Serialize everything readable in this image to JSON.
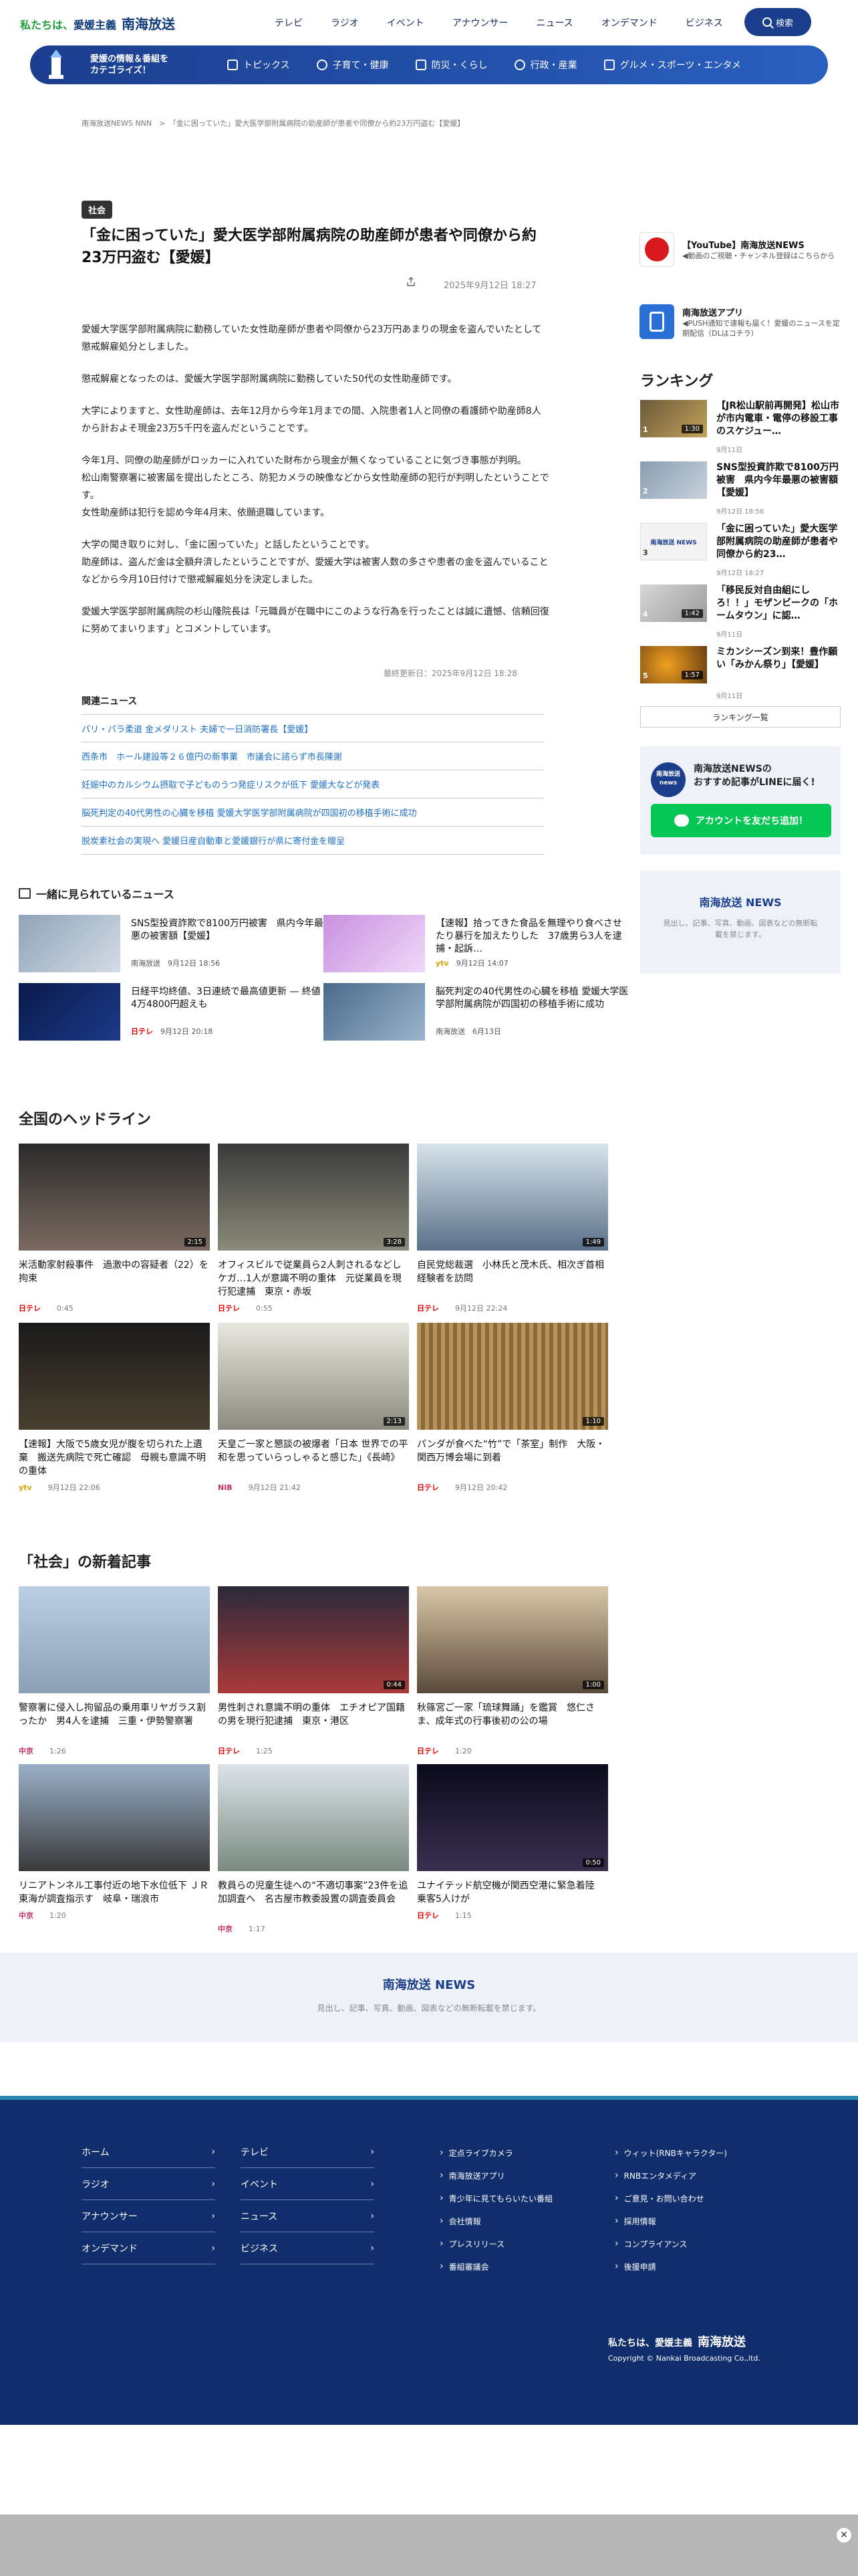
{
  "header": {
    "tagline_prefix": "私たちは、",
    "tagline_brand": "愛媛主義",
    "brand": "南海放送",
    "nav": [
      "テレビ",
      "ラジオ",
      "イベント",
      "アナウンサー",
      "ニュース",
      "オンデマンド",
      "ビジネス"
    ],
    "search_label": "検索"
  },
  "subnav": {
    "promo": "愛媛の情報＆番組を\nカテゴライズ！",
    "items": [
      "トピックス",
      "子育て・健康",
      "防災・くらし",
      "行政・産業",
      "グルメ・スポーツ・エンタメ"
    ]
  },
  "breadcrumb": "南海放送NEWS NNN　>　「金に困っていた」愛大医学部附属病院の助産師が患者や同僚から約23万円盗む【愛媛】",
  "article": {
    "category": "社会",
    "title": "「金に困っていた」愛大医学部附属病院の助産師が患者や同僚から約23万円盗む【愛媛】",
    "date": "2025年9月12日 18:27",
    "paragraphs": [
      "愛媛大学医学部附属病院に勤務していた女性助産師が患者や同僚から23万円あまりの現金を盗んでいたとして懲戒解雇処分としました。",
      "懲戒解雇となったのは、愛媛大学医学部附属病院に勤務していた50代の女性助産師です。",
      "大学によりますと、女性助産師は、去年12月から今年1月までの間、入院患者1人と同僚の看護師や助産師8人から計およそ現金23万5千円を盗んだということです。",
      "今年1月、同僚の助産師がロッカーに入れていた財布から現金が無くなっていることに気づき事態が判明。\n松山南警察署に被害届を提出したところ、防犯カメラの映像などから女性助産師の犯行が判明したということです。\n女性助産師は犯行を認め今年4月末、依願退職しています。",
      "大学の聞き取りに対し、「金に困っていた」と話したということです。\n助産師は、盗んだ金は全額弁済したということですが、愛媛大学は被害人数の多さや患者の金を盗んでいることなどから今月10日付けで懲戒解雇処分を決定しました。",
      "愛媛大学医学部附属病院の杉山隆院長は「元職員が在職中にこのような行為を行ったことは誠に遺憾、信頼回復に努めてまいります」とコメントしています。"
    ],
    "updated": "最終更新日：2025年9月12日 18:28"
  },
  "related": {
    "heading": "関連ニュース",
    "items": [
      "パリ・パラ柔道 金メダリスト 夫婦で一日消防署長【愛媛】",
      "西条市　ホール建設等２６億円の新事業　市議会に諮らず市長陳謝",
      "妊娠中のカルシウム摂取で子どものうつ発症リスクが低下 愛媛大などが発表",
      "脳死判定の40代男性の心臓を移植 愛媛大学医学部附属病院が四国初の移植手術に成功",
      "脱炭素社会の実現へ 愛媛日産自動車と愛媛銀行が県に寄付金を贈呈"
    ]
  },
  "sidebar": {
    "cards": [
      {
        "title": "【YouTube】南海放送NEWS",
        "desc": "◀動画のご視聴・チャンネル登録はこちらから"
      },
      {
        "title": "南海放送アプリ",
        "desc": "◀PUSH通知で速報も届く！愛媛のニュースを定期配信（DLはコチラ）"
      }
    ],
    "ranking_heading": "ランキング",
    "ranking": [
      {
        "title": "【JR松山駅前再開発】松山市が市内電車・電停の移設工事のスケジュー…",
        "date": "9月11日",
        "dur": "1:30"
      },
      {
        "title": "SNS型投資詐欺で8100万円被害　県内今年最悪の被害額【愛媛】",
        "date": "9月12日 18:56",
        "dur": ""
      },
      {
        "title": "「金に困っていた」愛大医学部附属病院の助産師が患者や同僚から約23…",
        "date": "9月12日 18:27",
        "dur": ""
      },
      {
        "title": "「移民反対自由組にしろ！！」モザンビークの「ホームタウン」に認…",
        "date": "9月11日",
        "dur": "1:42"
      },
      {
        "title": "ミカンシーズン到来！豊作願い「みかん祭り」【愛媛】",
        "date": "9月11日",
        "dur": "1:57"
      }
    ],
    "ranking_more": "ランキング一覧",
    "line_title": "南海放送NEWSの\nおすすめ記事がLINEに届く!",
    "line_logo": "南海放送\nnews",
    "line_button": "アカウントを友だち追加！",
    "banner_logo": "南海放送 NEWS",
    "banner_desc": "見出し、記事、写真、動画、図表などの無断転載を禁じます。"
  },
  "watch": {
    "heading": "一緒に見られているニュース",
    "items": [
      {
        "title": "SNS型投資詐欺で8100万円被害　県内今年最悪の被害額【愛媛】",
        "src": "南海放送",
        "date": "9月12日 18:56"
      },
      {
        "title": "【速報】拾ってきた食品を無理やり食べさせたり暴行を加えたりした　37歳男ら3人を逮捕・起訴…",
        "src": "ytv",
        "date": "9月12日 14:07"
      },
      {
        "title": "日経平均終値、3日連続で最高値更新 — 終値4万4800円超えも",
        "src": "日テレ",
        "date": "9月12日 20:18"
      },
      {
        "title": "脳死判定の40代男性の心臓を移植 愛媛大学医学部附属病院が四国初の移植手術に成功",
        "src": "南海放送",
        "date": "6月13日"
      }
    ]
  },
  "headlines": {
    "heading": "全国のヘッドライン",
    "items": [
      {
        "title": "米活動家射殺事件　過激中の容疑者（22）を拘束",
        "src": "日テレ",
        "date": "0:45"
      },
      {
        "title": "オフィスビルで従業員ら2人刺されるなどしケガ…1人が意識不明の重体　元従業員を現行犯逮捕　東京・赤坂",
        "src": "日テレ",
        "date": "0:55"
      },
      {
        "title": "自民党総裁選　小林氏と茂木氏、相次ぎ首相経験者を訪問",
        "src": "日テレ",
        "date": "9月12日 22:24"
      },
      {
        "title": "【速報】大阪で5歳女児が腹を切られた上遺棄　搬送先病院で死亡確認　母親も意識不明の重体",
        "src": "ytv",
        "date": "9月12日 22:06"
      },
      {
        "title": "天皇ご一家と懇談の被爆者「日本 世界での平和を思っていらっしゃると感じた」《長崎》",
        "src": "NIB",
        "date": "9月12日 21:42"
      },
      {
        "title": "パンダが食べた“竹”で「茶室」制作　大阪・関西万博会場に到着",
        "src": "日テレ",
        "date": "9月12日 20:42"
      }
    ]
  },
  "society": {
    "heading": "「社会」の新着記事",
    "items": [
      {
        "title": "警察署に侵入し拘留品の乗用車リヤガラス割ったか　男4人を逮捕　三重・伊勢警察署",
        "src": "中京",
        "date": "1:26"
      },
      {
        "title": "男性刺され意識不明の重体　エチオピア国籍の男を現行犯逮捕　東京・港区",
        "src": "日テレ",
        "date": "1:25"
      },
      {
        "title": "秋篠宮ご一家「琉球舞踊」を鑑賞　悠仁さま、成年式の行事後初の公の場",
        "src": "日テレ",
        "date": "1:20"
      },
      {
        "title": "リニアトンネル工事付近の地下水位低下 ＪＲ東海が調査指示す　岐阜・瑞浪市",
        "src": "中京",
        "date": "1:20"
      },
      {
        "title": "教員らの児童生徒への“不適切事案”23件を追加調査へ　名古屋市教委設置の調査委員会",
        "src": "中京",
        "date": "1:17"
      },
      {
        "title": "ユナイテッド航空機が関西空港に緊急着陸　乗客5人けが",
        "src": "日テレ",
        "date": "1:15"
      }
    ]
  },
  "wide_banner": {
    "logo": "南海放送 NEWS",
    "desc": "見出し、記事、写真、動画、図表などの無断転載を禁じます。"
  },
  "footer": {
    "col1": [
      "ホーム",
      "ラジオ",
      "アナウンサー",
      "オンデマンド"
    ],
    "col2": [
      "テレビ",
      "イベント",
      "ニュース",
      "ビジネス"
    ],
    "list1": [
      "定点ライブカメラ",
      "南海放送アプリ",
      "青少年に見てもらいたい番組",
      "会社情報",
      "プレスリリース",
      "番組審議会"
    ],
    "list2": [
      "ウィット(RNBキャラクター)",
      "RNBエンタメディア",
      "ご意見・お問い合わせ",
      "採用情報",
      "コンプライアンス",
      "後援申請"
    ],
    "brand_prefix": "私たちは、愛媛主義",
    "brand": "南海放送",
    "copyright": "Copyright © Nankai Broadcasting Co.,ltd."
  },
  "colors": {
    "brand": "#0f3a7a",
    "accent": "#1a3d8c",
    "link": "#1d6fc5",
    "line": "#06c755",
    "footer": "#102d6c"
  }
}
